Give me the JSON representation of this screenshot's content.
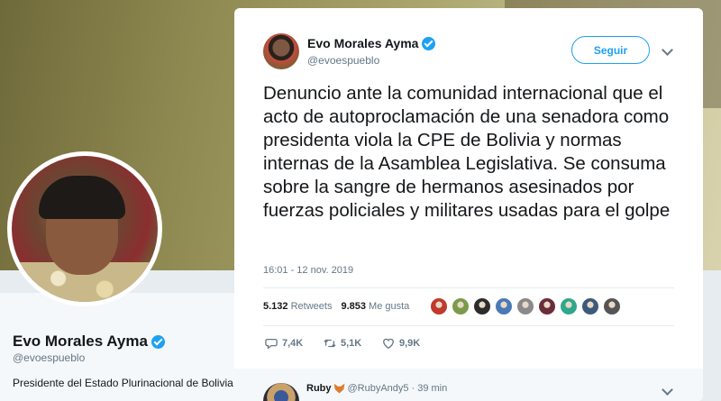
{
  "profile": {
    "name": "Evo Morales Ayma",
    "handle": "@evoespueblo",
    "bio": "Presidente del Estado Plurinacional de Bolivia."
  },
  "tweet": {
    "author_name": "Evo Morales Ayma",
    "author_handle": "@evoespueblo",
    "follow_label": "Seguir",
    "text": "Denuncio ante la comunidad internacional que el acto de autoproclamación de una senadora como presidenta viola la CPE de Bolivia y normas internas de la Asamblea Legislativa. Se consuma sobre la sangre de hermanos asesinados por fuerzas policiales y militares usadas para el golpe",
    "timestamp": "16:01 - 12 nov. 2019",
    "retweets_count": "5.132",
    "retweets_label": "Retweets",
    "likes_count": "9.853",
    "likes_label": "Me gusta",
    "liker_avatars": [
      "#c0392b",
      "#7a9b4a",
      "#2c2c2c",
      "#4a7ab5",
      "#8a8a8a",
      "#6b2d3a",
      "#2fa88a",
      "#3e5a7a",
      "#555555"
    ],
    "actions": {
      "replies": "7,4K",
      "retweets": "5,1K",
      "likes": "9,9K"
    }
  },
  "reply": {
    "name": "Ruby",
    "handle": "@RubyAndy5",
    "separator": "·",
    "time": "39 min"
  },
  "colors": {
    "accent": "#1da1f2",
    "secondary_text": "#657786",
    "primary_text": "#14171a"
  }
}
